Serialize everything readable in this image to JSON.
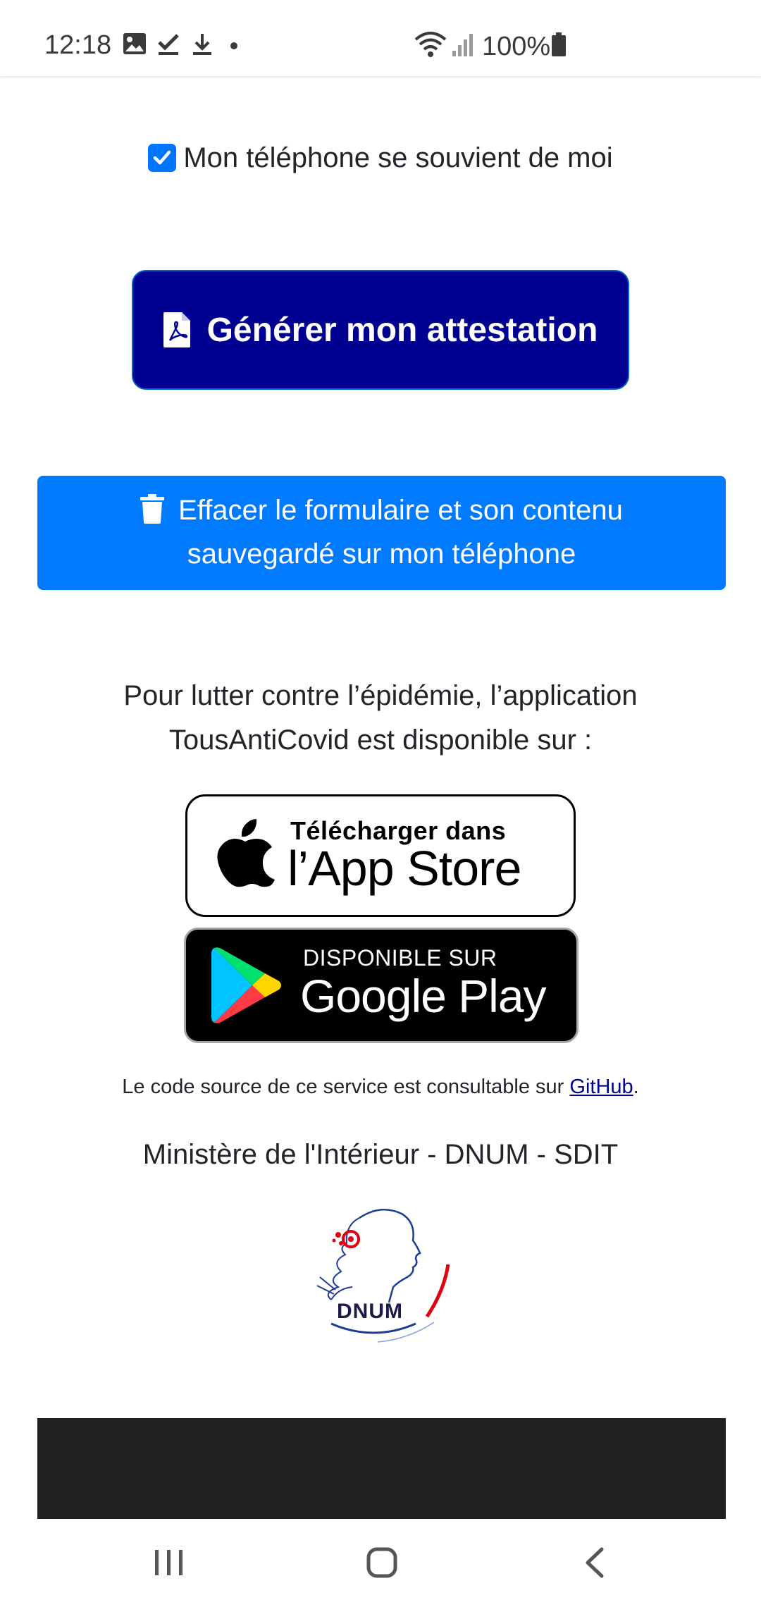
{
  "status_bar": {
    "time": "12:18",
    "battery": "100%",
    "icons": [
      "gallery-icon",
      "check-icon",
      "download-icon",
      "dot-icon",
      "wifi-icon",
      "signal-icon",
      "battery-icon"
    ]
  },
  "form": {
    "remember_label": "Mon téléphone se souvient de moi",
    "remember_checked": true,
    "generate_label": "Générer mon attestation",
    "erase_label_line1": "Effacer le formulaire et son contenu",
    "erase_label_line2": "sauvegardé sur mon téléphone"
  },
  "info": {
    "line1": "Pour lutter contre l’épidémie, l’application",
    "line2": "TousAntiCovid est disponible sur :"
  },
  "badges": {
    "appstore_line1": "Télécharger dans",
    "appstore_line2": "l’App Store",
    "googleplay_line1": "DISPONIBLE SUR",
    "googleplay_line2": "Google Play"
  },
  "footer": {
    "source_prefix": "Le code source de ce service est consultable sur ",
    "github_label": "GitHub",
    "source_suffix": ".",
    "ministry": "Ministère de l'Intérieur - DNUM - SDIT",
    "logo_text": "DNUM"
  },
  "colors": {
    "primary_dark": "#000091",
    "primary_blue": "#007bff",
    "checkbox": "#0075ff",
    "footer_dark": "#212121"
  }
}
